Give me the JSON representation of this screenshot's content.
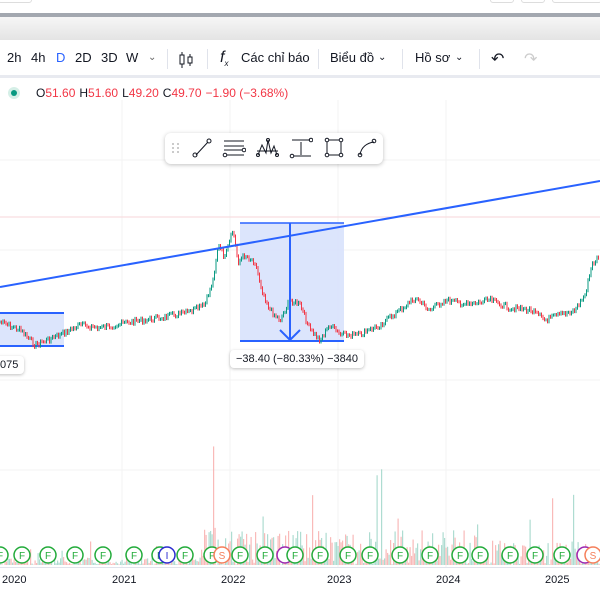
{
  "toolbar": {
    "intervals": [
      "2h",
      "4h",
      "D",
      "2D",
      "3D",
      "W"
    ],
    "active_interval": "D",
    "indicators_label": "Các chỉ báo",
    "chart_label": "Biểu đồ",
    "profile_label": "Hồ sơ"
  },
  "legend": {
    "o_label": "O",
    "o": "51.60",
    "h_label": "H",
    "h": "51.60",
    "l_label": "L",
    "l": "49.20",
    "c_label": "C",
    "c": "49.70",
    "change": "−1.90 (−3.68%)"
  },
  "measure": {
    "left_label": "075",
    "right_label": "−38.40 (−80.33%) −3840"
  },
  "x_axis": [
    "2020",
    "2021",
    "2022",
    "2023",
    "2024",
    "2025"
  ],
  "events": [
    "F",
    "F",
    "F",
    "F",
    "F",
    "F",
    "F",
    "I",
    "F",
    "F",
    "S",
    "F",
    "F",
    "D",
    "F",
    "F",
    "F",
    "F",
    "F",
    "F",
    "F",
    "F",
    "F",
    "F",
    "F",
    "D",
    "S"
  ],
  "colors": {
    "up": "#089981",
    "down": "#f23645",
    "accent": "#2962ff",
    "box": "#d6e0fc"
  }
}
